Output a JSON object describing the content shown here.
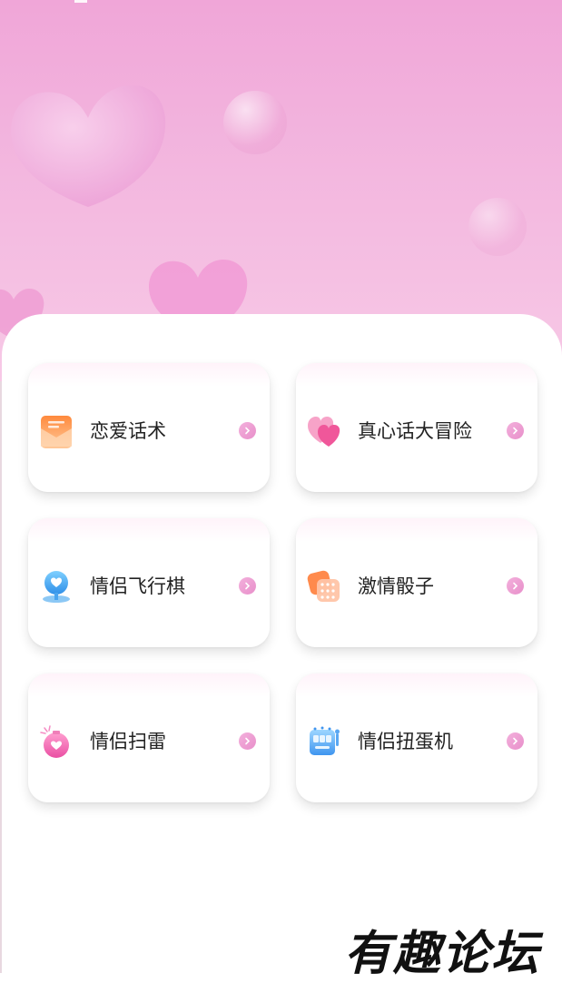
{
  "features": [
    {
      "label": "恋爱话术",
      "icon": "envelope-icon"
    },
    {
      "label": "真心话大冒险",
      "icon": "hearts-icon"
    },
    {
      "label": "情侣飞行棋",
      "icon": "map-pin-icon"
    },
    {
      "label": "激情骰子",
      "icon": "dice-icon"
    },
    {
      "label": "情侣扫雷",
      "icon": "heart-bomb-icon"
    },
    {
      "label": "情侣扭蛋机",
      "icon": "gacha-machine-icon"
    }
  ],
  "watermark": "有趣论坛",
  "colors": {
    "accent_pink": "#e88fca",
    "hero_top": "#f0a6d8",
    "hero_bottom": "#f7c9e6"
  }
}
